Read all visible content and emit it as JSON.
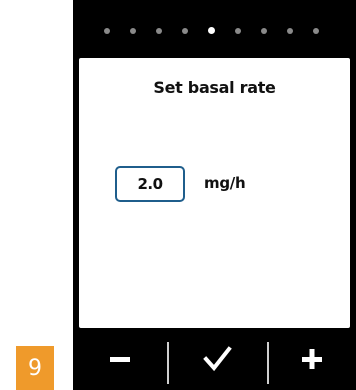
{
  "screen": {
    "title": "Set basal rate",
    "value": "2.0",
    "unit": "mg/h"
  },
  "pager": {
    "total": 9,
    "active_index": 4
  },
  "buttons": {
    "minus_icon": "minus-icon",
    "confirm_icon": "checkmark-icon",
    "plus_icon": "plus-icon"
  },
  "badge": {
    "label": "9"
  },
  "colors": {
    "device": "#000000",
    "screen": "#ffffff",
    "value_border": "#1f5e8c",
    "badge": "#ef9a2b"
  }
}
